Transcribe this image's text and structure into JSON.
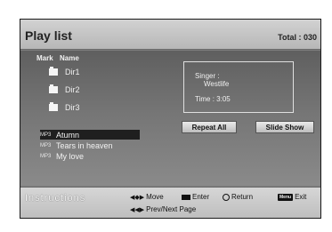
{
  "header": {
    "title": "Play list",
    "total": "Total : 030"
  },
  "columns": {
    "mark": "Mark",
    "name": "Name"
  },
  "directories": [
    {
      "label": "Dir1"
    },
    {
      "label": "Dir2"
    },
    {
      "label": "Dir3"
    }
  ],
  "files": [
    {
      "type": "MP3",
      "name": "Atumn",
      "selected": true
    },
    {
      "type": "MP3",
      "name": "Tears in heaven",
      "selected": false
    },
    {
      "type": "MP3",
      "name": "My love",
      "selected": false
    }
  ],
  "info": {
    "singer_label": "Singer :",
    "singer_value": "Westlife",
    "time": "Time :  3:05"
  },
  "buttons": {
    "repeat_all": "Repeat All",
    "slide_show": "Slide Show"
  },
  "footer": {
    "label": "Instructions",
    "move": "Move",
    "enter": "Enter",
    "return": "Return",
    "menu_key": "Menu",
    "exit": "Exit",
    "page": "Prev/Next Page"
  }
}
